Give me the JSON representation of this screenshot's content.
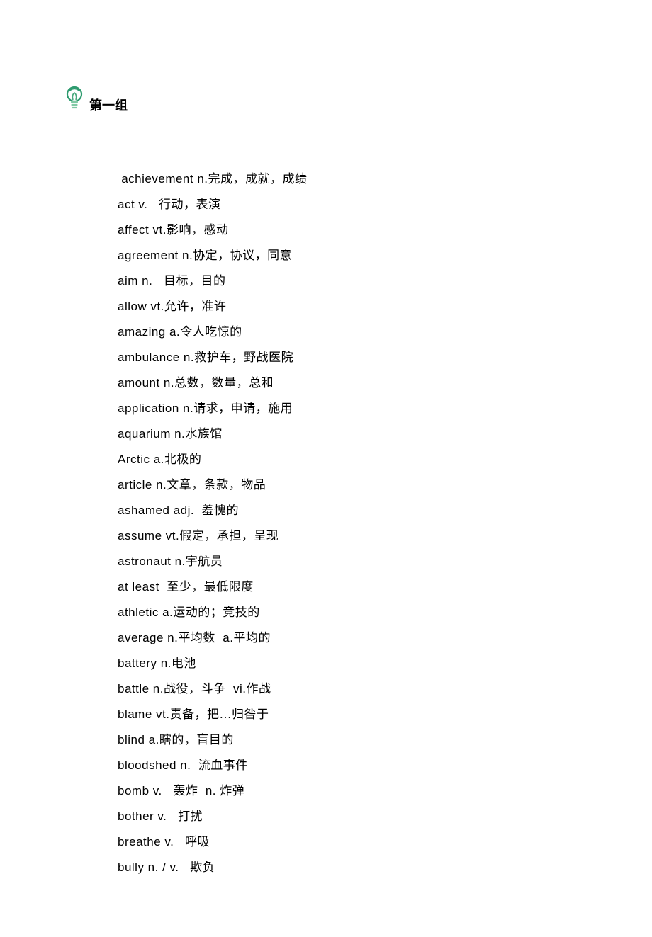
{
  "header": {
    "title": "第一组"
  },
  "entries": [
    {
      "en": " achievement n.",
      "zh": "完成，成就，成绩"
    },
    {
      "en": "act v.   ",
      "zh": "行动，表演"
    },
    {
      "en": "affect vt.",
      "zh": "影响，感动"
    },
    {
      "en": "agreement n.",
      "zh": "协定，协议，同意"
    },
    {
      "en": "aim n.   ",
      "zh": "目标，目的"
    },
    {
      "en": "allow vt.",
      "zh": "允许，准许"
    },
    {
      "en": "amazing a.",
      "zh": "令人吃惊的"
    },
    {
      "en": "ambulance n.",
      "zh": "救护车，野战医院"
    },
    {
      "en": "amount n.",
      "zh": "总数，数量，总和"
    },
    {
      "en": "application n.",
      "zh": "请求，申请，施用"
    },
    {
      "en": "aquarium n.",
      "zh": "水族馆"
    },
    {
      "en": "Arctic a.",
      "zh": "北极的"
    },
    {
      "en": "article n.",
      "zh": "文章，条款，物品"
    },
    {
      "en": "ashamed adj.  ",
      "zh": "羞愧的"
    },
    {
      "en": "assume vt.",
      "zh": "假定，承担，呈现"
    },
    {
      "en": "astronaut n.",
      "zh": "宇航员"
    },
    {
      "en": "at least  ",
      "zh": "至少，最低限度"
    },
    {
      "en": "athletic a.",
      "zh": "运动的；竞技的"
    },
    {
      "en": "average n.",
      "zh": "平均数",
      "en2": "  a.",
      "zh2": "平均的"
    },
    {
      "en": "battery n.",
      "zh": "电池"
    },
    {
      "en": "battle n.",
      "zh": "战役，斗争",
      "en2": "  vi.",
      "zh2": "作战"
    },
    {
      "en": "blame vt.",
      "zh": "责备，把…归咎于"
    },
    {
      "en": "blind a.",
      "zh": "瞎的，盲目的"
    },
    {
      "en": "bloodshed n.  ",
      "zh": "流血事件"
    },
    {
      "en": "bomb v.   ",
      "zh": "轰炸",
      "en2": "  n. ",
      "zh2": "炸弹"
    },
    {
      "en": "bother v.   ",
      "zh": "打扰"
    },
    {
      "en": "breathe v.   ",
      "zh": "呼吸"
    },
    {
      "en": "bully n. / v.   ",
      "zh": "欺负"
    }
  ]
}
